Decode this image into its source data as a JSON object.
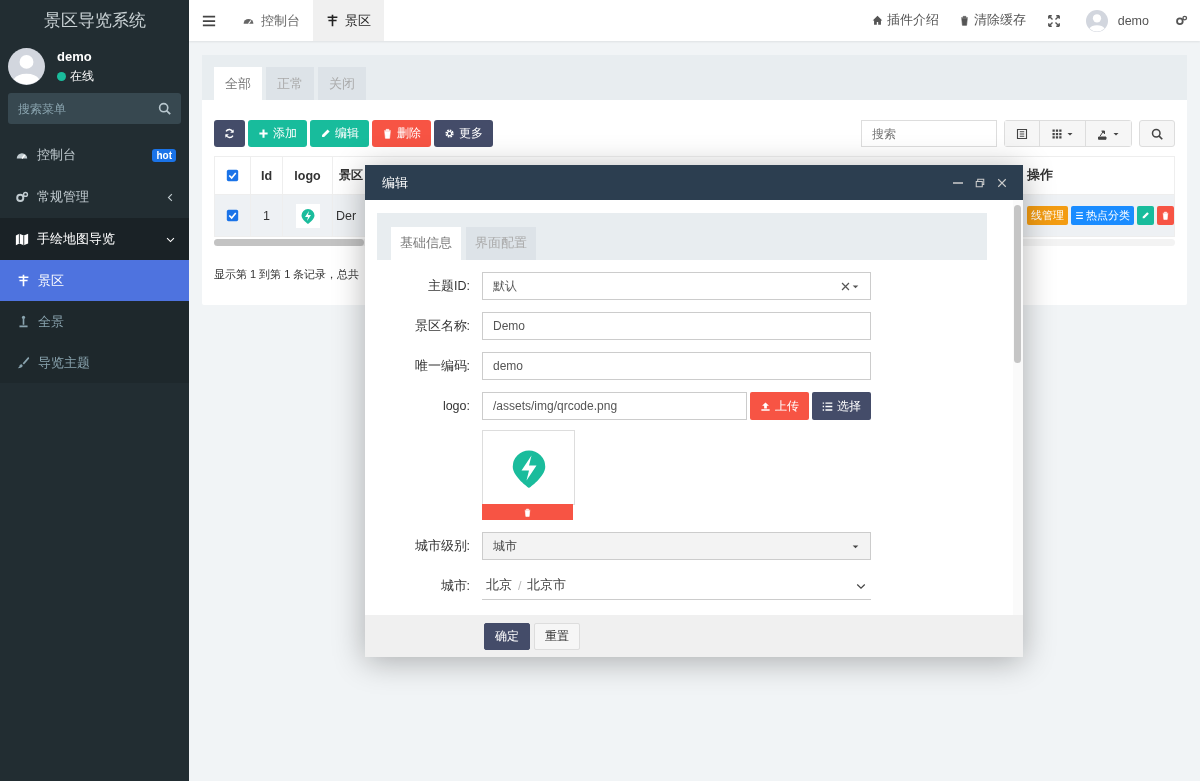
{
  "sidebar": {
    "title": "景区导览系统",
    "user": {
      "name": "demo",
      "status": "在线"
    },
    "search": {
      "placeholder": "搜索菜单"
    },
    "menu": [
      {
        "label": "控制台",
        "badge": "hot",
        "expanded": false
      },
      {
        "label": "常规管理",
        "expanded": false
      },
      {
        "label": "手绘地图导览",
        "expanded": true,
        "children": [
          {
            "label": "景区",
            "selected": true
          },
          {
            "label": "全景",
            "selected": false
          },
          {
            "label": "导览主题",
            "selected": false
          }
        ]
      }
    ]
  },
  "header": {
    "tabs": [
      {
        "label": "控制台",
        "selected": false
      },
      {
        "label": "景区",
        "selected": true
      }
    ],
    "links": [
      "插件介绍",
      "清除缓存"
    ],
    "user": "demo"
  },
  "content": {
    "filter_tabs": [
      {
        "label": "全部",
        "selected": true
      },
      {
        "label": "正常",
        "selected": false
      },
      {
        "label": "关闭",
        "selected": false
      }
    ],
    "toolbar": [
      {
        "kind": "refresh"
      },
      {
        "kind": "add",
        "label": "添加"
      },
      {
        "kind": "edit",
        "label": "编辑"
      },
      {
        "kind": "delete",
        "label": "删除"
      },
      {
        "kind": "more",
        "label": "更多"
      }
    ],
    "search": {
      "placeholder": "搜索"
    },
    "table": {
      "all_checked": true,
      "columns": [
        "Id",
        "logo",
        "景区"
      ],
      "action_column": "操作",
      "rows": [
        {
          "checked": true,
          "id": "1",
          "name": "Der",
          "actions": [
            "线管理",
            "热点分类"
          ]
        }
      ]
    },
    "summary": "显示第 1 到第 1 条记录，总共"
  },
  "dialog": {
    "title": "编辑",
    "tabs": [
      {
        "label": "基础信息",
        "selected": true
      },
      {
        "label": "界面配置",
        "selected": false
      }
    ],
    "fields": [
      {
        "kind": "select-clear",
        "label": "主题ID:",
        "value": "默认"
      },
      {
        "kind": "text",
        "label": "景区名称:",
        "value": "Demo"
      },
      {
        "kind": "text",
        "label": "唯一编码:",
        "value": "demo"
      },
      {
        "kind": "file",
        "label": "logo:",
        "value": "/assets/img/qrcode.png",
        "buttons": [
          "上传",
          "选择"
        ]
      },
      {
        "kind": "select",
        "label": "城市级别:",
        "value": "城市"
      },
      {
        "kind": "cascader",
        "label": "城市:",
        "parts": [
          "北京",
          "北京市"
        ],
        "separator": "/"
      }
    ],
    "buttons": [
      {
        "label": "确定",
        "primary": true
      },
      {
        "label": "重置",
        "primary": false
      }
    ]
  }
}
